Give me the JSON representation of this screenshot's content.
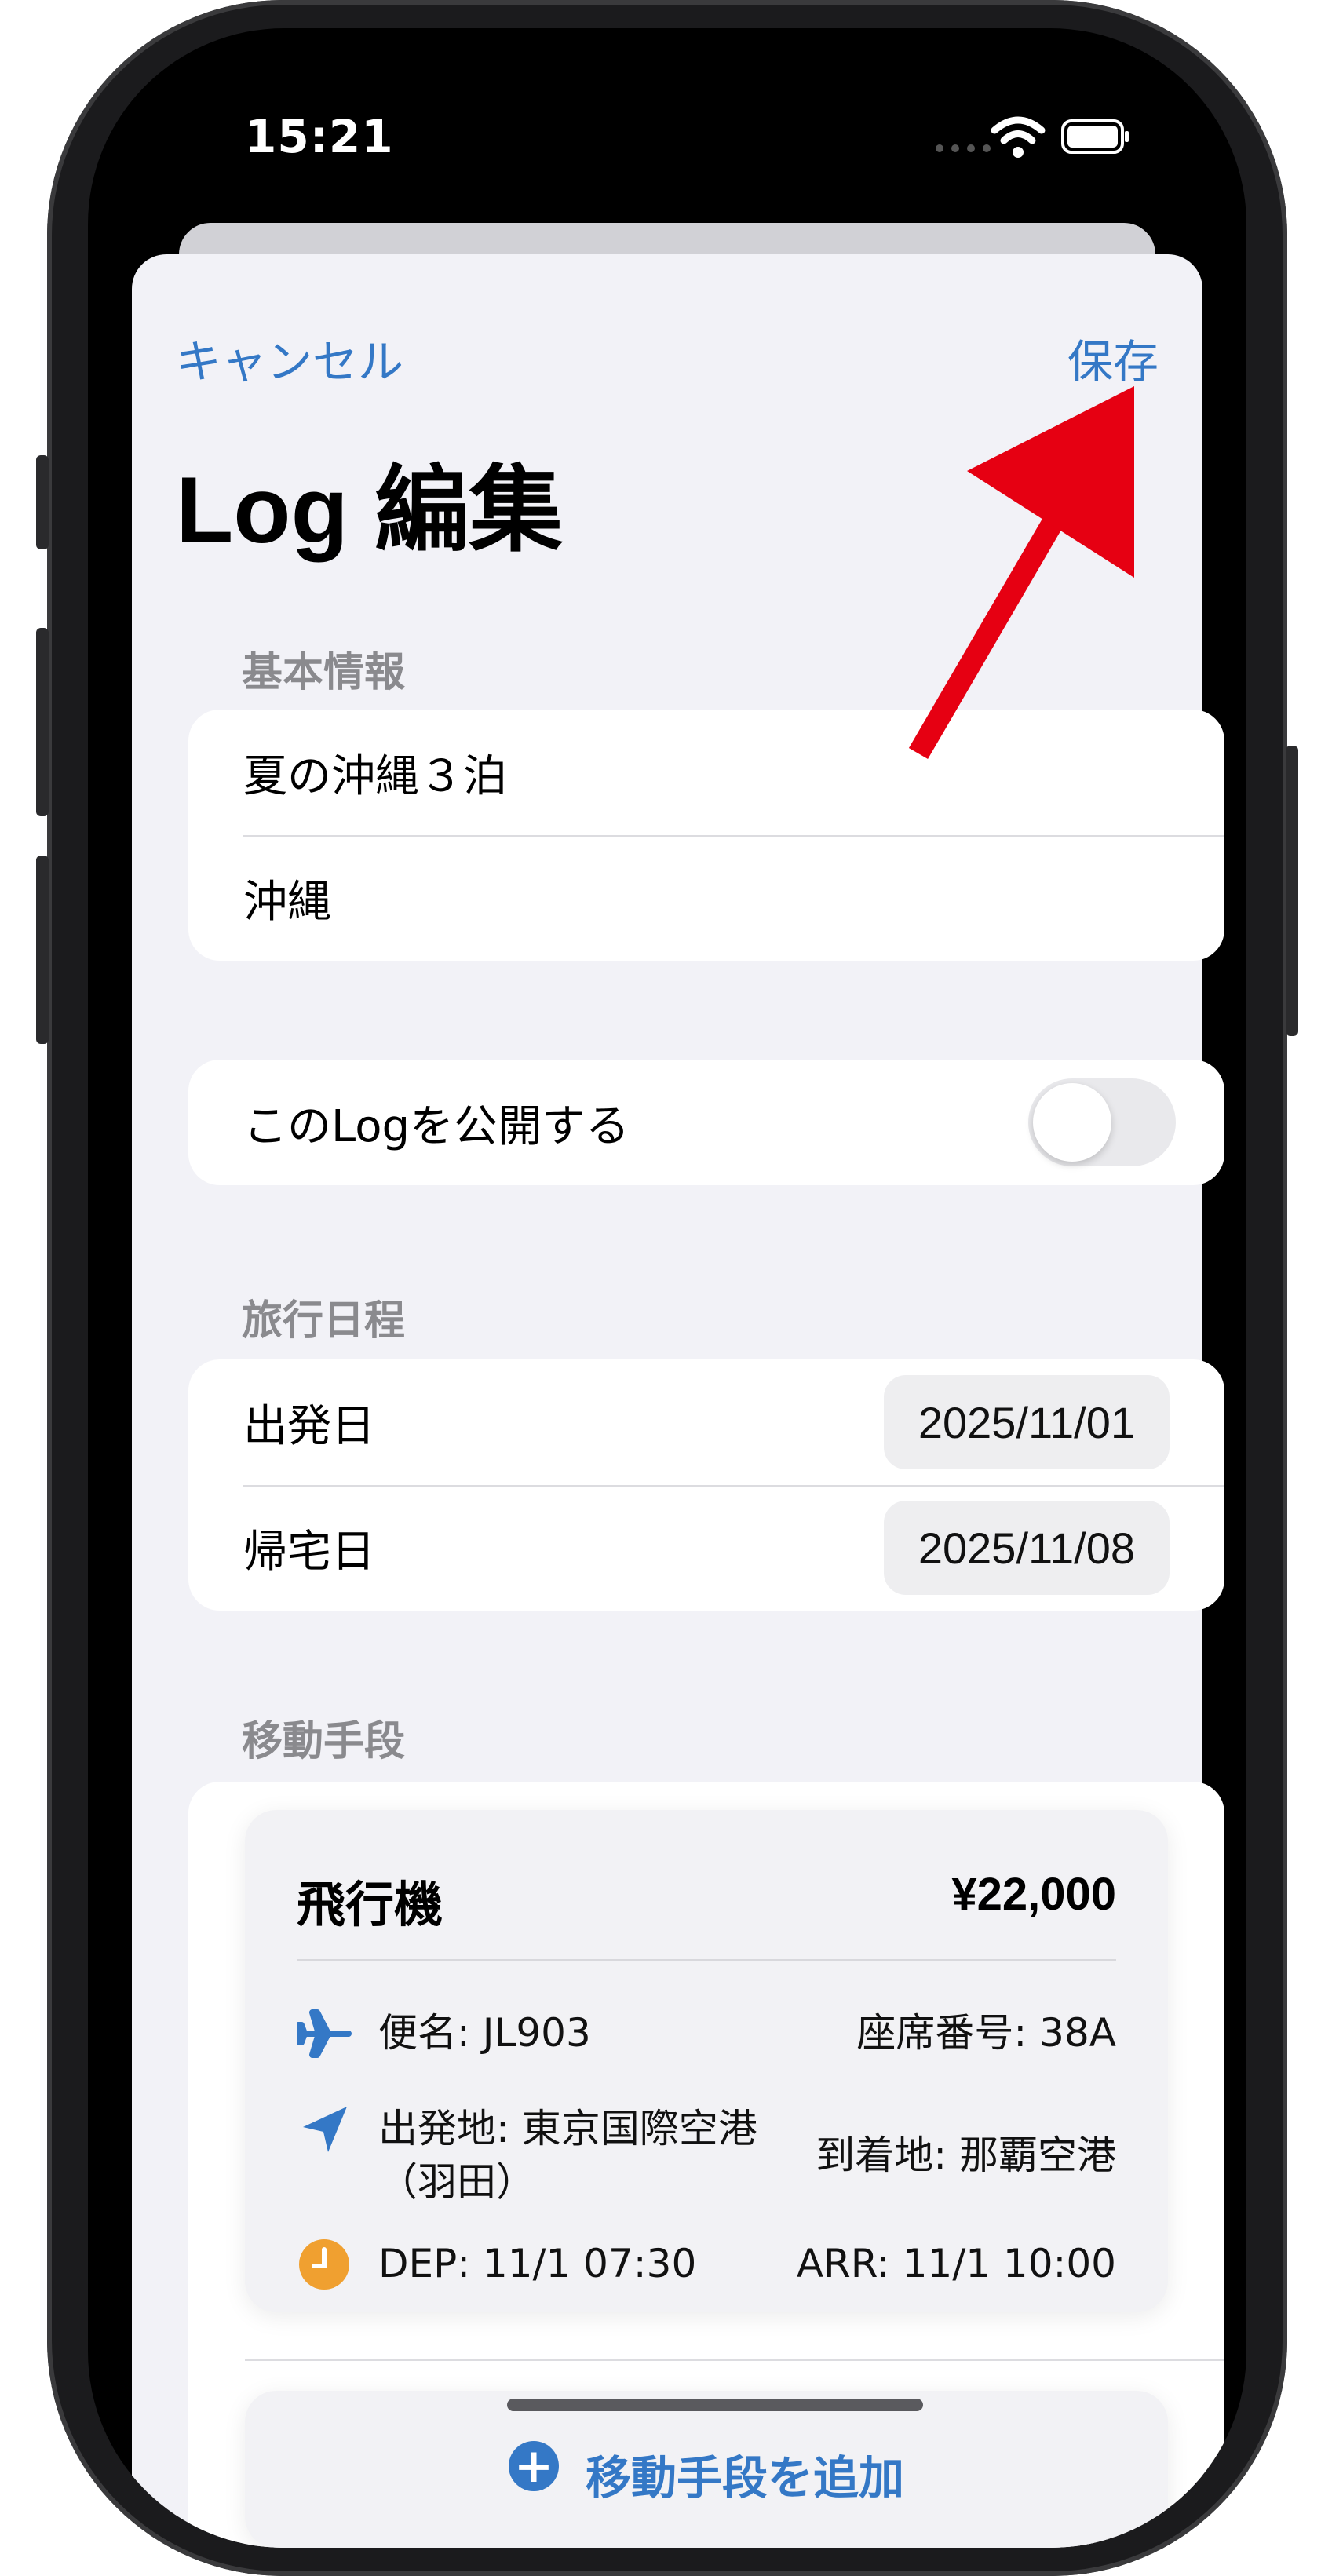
{
  "status_bar": {
    "time": "15:21"
  },
  "nav": {
    "cancel_label": "キャンセル",
    "save_label": "保存"
  },
  "page": {
    "title": "Log 編集"
  },
  "basic_info": {
    "section_label": "基本情報",
    "title_value": "夏の沖縄３泊",
    "location_value": "沖縄"
  },
  "publish": {
    "label": "このLogを公開する",
    "enabled": false
  },
  "schedule": {
    "section_label": "旅行日程",
    "departure_label": "出発日",
    "departure_value": "2025/11/01",
    "return_label": "帰宅日",
    "return_value": "2025/11/08"
  },
  "transport": {
    "section_label": "移動手段",
    "items": [
      {
        "type": "飛行機",
        "price": "¥22,000",
        "flight": "便名: JL903",
        "seat": "座席番号: 38A",
        "from": "出発地: 東京国際空港（羽田）",
        "to": "到着地: 那覇空港",
        "dep": "DEP: 11/1 07:30",
        "arr": "ARR: 11/1 10:00"
      }
    ],
    "add_label": "移動手段を追加"
  },
  "colors": {
    "accent": "#3478c6",
    "clock_icon": "#f0a030",
    "annotation_arrow": "#e60012"
  },
  "icons": [
    "airplane-icon",
    "location-arrow-icon",
    "clock-icon",
    "plus-circle-icon",
    "wifi-icon",
    "battery-icon"
  ]
}
